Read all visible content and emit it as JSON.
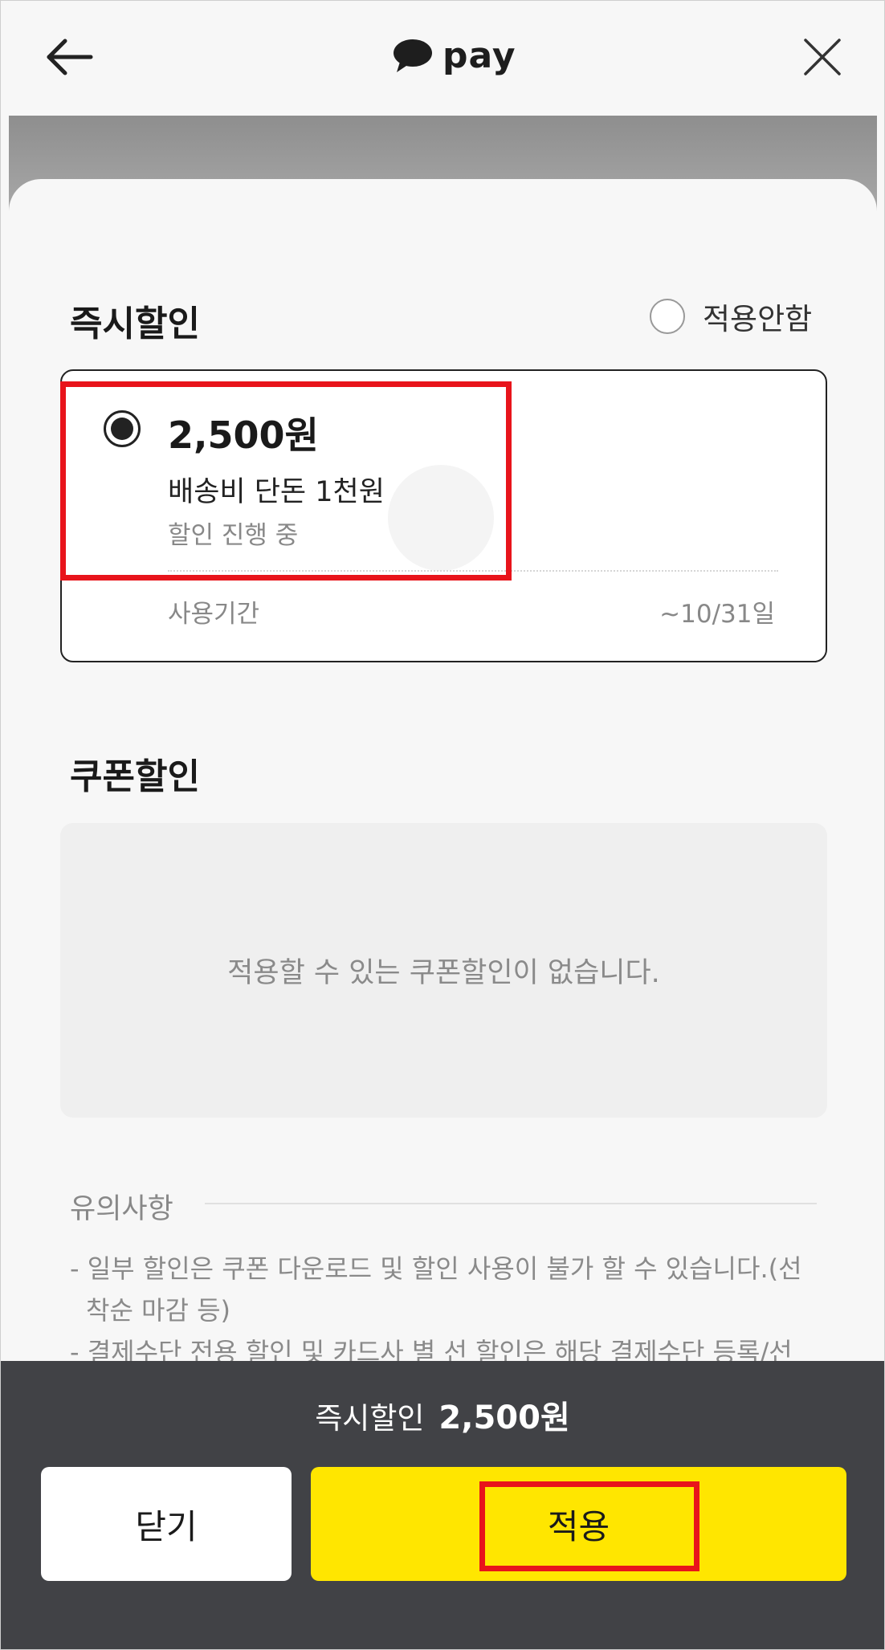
{
  "header": {
    "logo_text": "pay",
    "back_icon": "arrow-left-icon",
    "close_icon": "close-icon",
    "logo_icon": "speech-bubble-icon"
  },
  "instant_discount": {
    "title": "즉시할인",
    "no_apply_label": "적용안함",
    "offer": {
      "amount": "2,500원",
      "name": "배송비 단돈 1천원",
      "status": "할인 진행 중",
      "period_label": "사용기간",
      "period_value": "~10/31일",
      "selected": true
    }
  },
  "coupon_discount": {
    "title": "쿠폰할인",
    "empty_text": "적용할 수 있는 쿠폰할인이 없습니다."
  },
  "notice": {
    "title": "유의사항",
    "items": [
      "- 일부 할인은 쿠폰 다운로드 및 할인 사용이 불가 할 수 있습니다.(선",
      "  착순 마감 등)",
      "- 결제수단 전용 할인 및 카드사 별 선 할인은 해당 결제수단 등록/선"
    ]
  },
  "footer": {
    "total_label": "즉시할인",
    "total_amount": "2,500원",
    "close_button": "닫기",
    "apply_button": "적용"
  },
  "colors": {
    "accent_yellow": "#ffe600",
    "footer_bg": "#414246",
    "highlight_red": "#e8141b"
  }
}
